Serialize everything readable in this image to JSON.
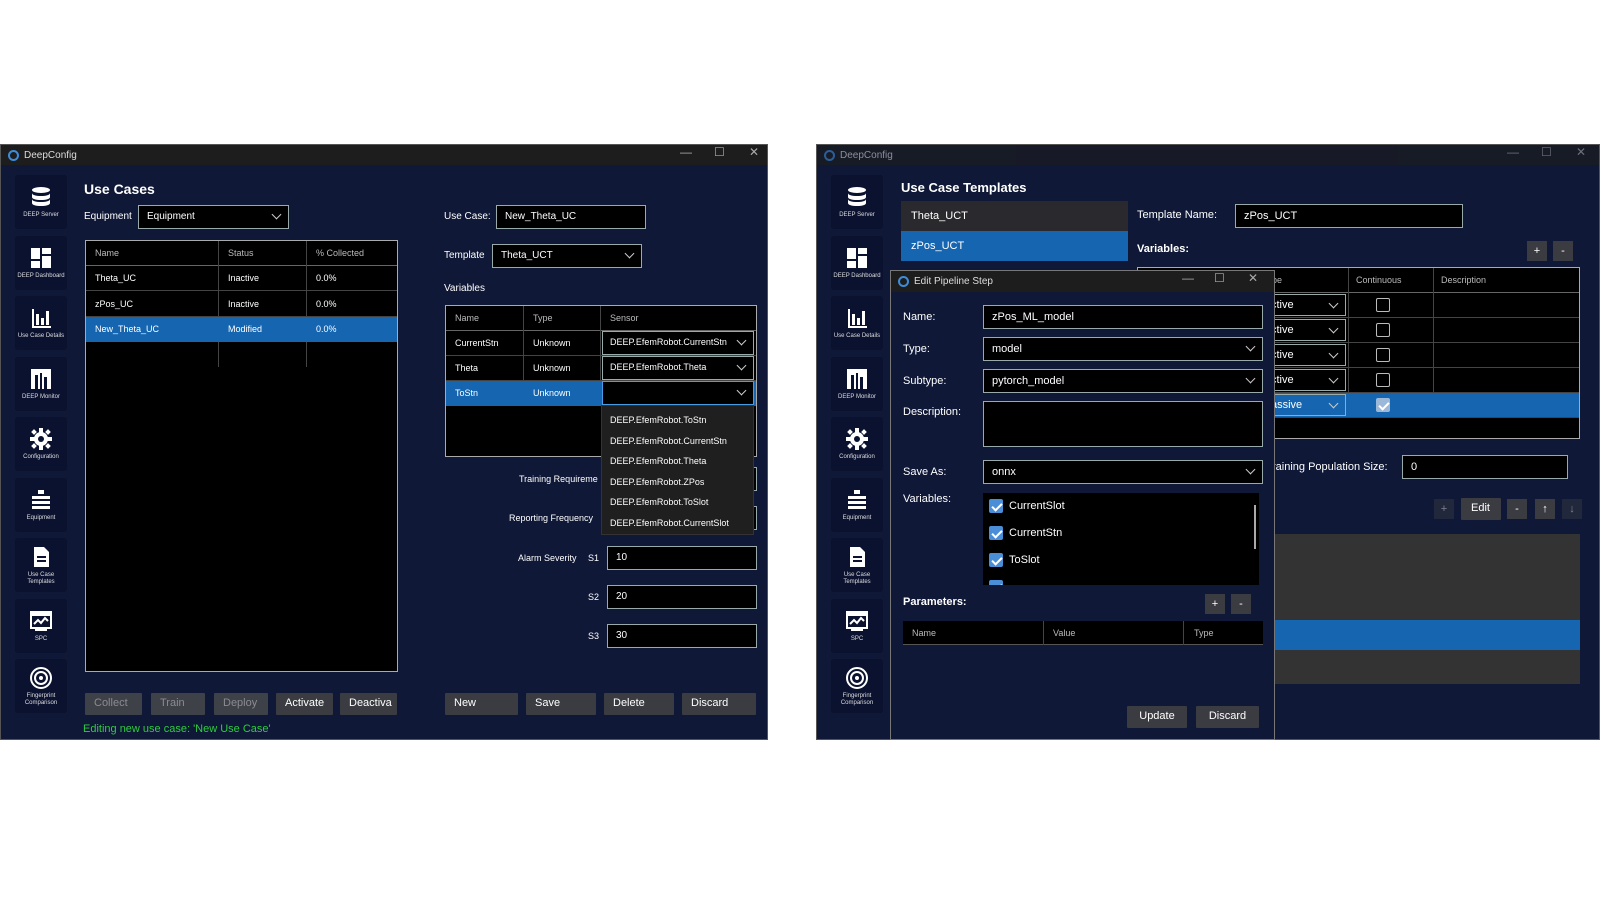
{
  "left": {
    "title": "DeepConfig",
    "nav": [
      {
        "label": "DEEP Server",
        "icon": "database-icon"
      },
      {
        "label": "DEEP Dashboard",
        "icon": "dashboard-icon"
      },
      {
        "label": "Use Case Details",
        "icon": "bar-chart-icon"
      },
      {
        "label": "DEEP Monitor",
        "icon": "monitor-icon"
      },
      {
        "label": "Configuration",
        "icon": "gear-icon"
      },
      {
        "label": "Equipment",
        "icon": "equipment-icon"
      },
      {
        "label": "Use Case Templates",
        "icon": "document-icon"
      },
      {
        "label": "SPC",
        "icon": "spc-icon"
      },
      {
        "label": "Fingerprint Comparison",
        "icon": "target-icon"
      }
    ],
    "heading": "Use Cases",
    "equipment_label": "Equipment",
    "equipment_value": "Equipment",
    "uc_cols": [
      "Name",
      "Status",
      "% Collected"
    ],
    "uc_rows": [
      [
        "Theta_UC",
        "Inactive",
        "0.0%"
      ],
      [
        "zPos_UC",
        "Inactive",
        "0.0%"
      ],
      [
        "New_Theta_UC",
        "Modified",
        "0.0%"
      ]
    ],
    "buttons": [
      "Collect",
      "Train",
      "Deploy",
      "Activate",
      "Deactiva"
    ],
    "status": "Editing new use case: 'New Use Case'",
    "use_case_label": "Use Case:",
    "use_case_value": "New_Theta_UC",
    "template_label": "Template",
    "template_value": "Theta_UCT",
    "variables_label": "Variables",
    "var_cols": [
      "Name",
      "Type",
      "Sensor"
    ],
    "var_rows": [
      [
        "CurrentStn",
        "Unknown",
        "DEEP.EfemRobot.CurrentStn"
      ],
      [
        "Theta",
        "Unknown",
        "DEEP.EfemRobot.Theta"
      ],
      [
        "ToStn",
        "Unknown",
        ""
      ]
    ],
    "dropdown": [
      "DEEP.EfemRobot.ToStn",
      "DEEP.EfemRobot.CurrentStn",
      "DEEP.EfemRobot.Theta",
      "DEEP.EfemRobot.ZPos",
      "DEEP.EfemRobot.ToSlot",
      "DEEP.EfemRobot.CurrentSlot"
    ],
    "training_label": "Training Requireme",
    "reporting_label": "Reporting Frequency",
    "alarm_label": "Alarm Severity",
    "s1": "S1",
    "s1_value": "10",
    "s2": "S2",
    "s2_value": "20",
    "s3": "S3",
    "s3_value": "30",
    "bottom": [
      "New",
      "Save",
      "Delete",
      "Discard"
    ]
  },
  "right": {
    "title": "DeepConfig",
    "heading": "Use Case Templates",
    "templates": [
      "Theta_UCT",
      "zPos_UCT"
    ],
    "template_name_label": "Template Name:",
    "template_name_value": "zPos_UCT",
    "variables_label": "Variables:",
    "plus": "+",
    "minus": "-",
    "col_type": "pe",
    "col_continuous": "Continuous",
    "col_description": "Description",
    "type_values": [
      "ctive",
      "ctive",
      "ctive",
      "ctive",
      "assive"
    ],
    "training_pop_label": "raining Population Size:",
    "training_pop_value": "0",
    "edit": "Edit",
    "up": "↑",
    "down": "↓",
    "dialog": {
      "title": "Edit Pipeline Step",
      "name_label": "Name:",
      "name_value": "zPos_ML_model",
      "type_label": "Type:",
      "type_value": "model",
      "subtype_label": "Subtype:",
      "subtype_value": "pytorch_model",
      "description_label": "Description:",
      "save_as_label": "Save As:",
      "save_as_value": "onnx",
      "variables_label": "Variables:",
      "variables": [
        "CurrentSlot",
        "CurrentStn",
        "ToSlot"
      ],
      "parameters_label": "Parameters:",
      "param_cols": [
        "Name",
        "Value",
        "Type"
      ],
      "update": "Update",
      "discard": "Discard"
    }
  }
}
